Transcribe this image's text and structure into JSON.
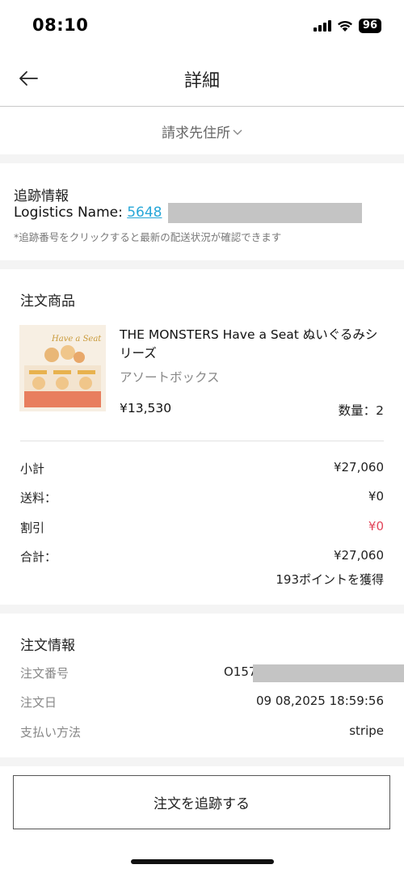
{
  "status_bar": {
    "time": "08:10",
    "battery": "96",
    "icons": [
      "cellular-signal-icon",
      "wifi-icon",
      "battery-icon"
    ]
  },
  "nav": {
    "title": "詳細",
    "back_icon": "arrow-left-icon"
  },
  "billing": {
    "label": "請求先住所",
    "chevron": "⌵"
  },
  "tracking": {
    "title": "追跡情報",
    "logistics_label": "Logistics Name: ",
    "tracking_number_visible": "5648",
    "note": "*追跡番号をクリックすると最新の配送状況が確認できます"
  },
  "products": {
    "title": "注文商品",
    "items": [
      {
        "name": "THE MONSTERS Have a Seat ぬいぐるみシリーズ",
        "variant": "アソートボックス",
        "price": "¥13,530",
        "quantity": "数量：2",
        "image_text": "Have a Seat"
      }
    ],
    "summary": {
      "subtotal_label": "小計",
      "subtotal_value": "¥27,060",
      "shipping_label": "送料：",
      "shipping_value": "¥0",
      "discount_label": "割引",
      "discount_value": "¥0",
      "total_label": "合計：",
      "total_value": "¥27,060",
      "points": "193ポイントを獲得"
    }
  },
  "order_info": {
    "title": "注文情報",
    "order_number_label": "注文番号",
    "order_number_visible": "O157",
    "order_date_label": "注文日",
    "order_date_value": "09 08,2025 18:59:56",
    "payment_label": "支払い方法",
    "payment_value": "stripe"
  },
  "actions": {
    "track_order": "注文を追跡する"
  },
  "colors": {
    "link": "#27a7d8",
    "discount": "#e2455a",
    "section_gap": "#f4f4f4",
    "redaction": "#c4c4c4"
  }
}
